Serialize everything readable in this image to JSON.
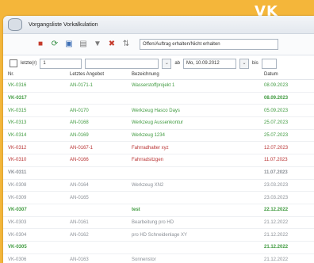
{
  "badge": "VK",
  "window": {
    "title": "Vorgangsliste Vorkalkulation"
  },
  "toolbar": {
    "filter_select": "Offen/Auftrag erhalten/Nicht erhalten"
  },
  "filterbar": {
    "checkbox_label": "letzte(r)",
    "count_value": "1",
    "unit_select": "",
    "ab_label": "ab",
    "date_value": "Mo, 10.09.2012",
    "bis_label": "bis"
  },
  "table": {
    "headers": [
      "Nr.",
      "Letztes Angebot",
      "Bezeichnung",
      "Datum"
    ],
    "rows": [
      {
        "nr": "VK-0316",
        "angebot": "AN-0171-1",
        "bez": "Wasserstoffprojekt 1",
        "datum": "08.09.2023",
        "style": "green"
      },
      {
        "nr": "VK-0317",
        "angebot": "",
        "bez": "",
        "datum": "08.09.2023",
        "style": "green-bold"
      },
      {
        "nr": "VK-0315",
        "angebot": "AN-0170",
        "bez": "Werkzeug Hasco Days",
        "datum": "05.09.2023",
        "style": "green"
      },
      {
        "nr": "VK-0313",
        "angebot": "AN-0168",
        "bez": "Werkzeug Aussenkontur",
        "datum": "25.07.2023",
        "style": "green"
      },
      {
        "nr": "VK-0314",
        "angebot": "AN-0169",
        "bez": "Werkzeug 1234",
        "datum": "25.07.2023",
        "style": "green"
      },
      {
        "nr": "VK-0312",
        "angebot": "AN-0167-1",
        "bez": "Fahrradhalter xyz",
        "datum": "12.07.2023",
        "style": "red"
      },
      {
        "nr": "VK-0310",
        "angebot": "AN-0166",
        "bez": "Fahrradsitzgen",
        "datum": "11.07.2023",
        "style": "red"
      },
      {
        "nr": "VK-0311",
        "angebot": "",
        "bez": "",
        "datum": "11.07.2023",
        "style": "gray-bold"
      },
      {
        "nr": "VK-0308",
        "angebot": "AN-0164",
        "bez": "Werkzeug XN2",
        "datum": "23.03.2023",
        "style": "gray"
      },
      {
        "nr": "VK-0309",
        "angebot": "AN-0165",
        "bez": "",
        "datum": "23.03.2023",
        "style": "gray"
      },
      {
        "nr": "VK-0307",
        "angebot": "",
        "bez": "test",
        "datum": "22.12.2022",
        "style": "green-bold"
      },
      {
        "nr": "VK-0303",
        "angebot": "AN-0161",
        "bez": "Bearbeitung pro HD",
        "datum": "21.12.2022",
        "style": "gray"
      },
      {
        "nr": "VK-0304",
        "angebot": "AN-0162",
        "bez": "pro HD Schneidenlage XY",
        "datum": "21.12.2022",
        "style": "gray"
      },
      {
        "nr": "VK-0305",
        "angebot": "",
        "bez": "",
        "datum": "21.12.2022",
        "style": "green-bold"
      },
      {
        "nr": "VK-0306",
        "angebot": "AN-0163",
        "bez": "Sonnenstor",
        "datum": "21.12.2022",
        "style": "gray"
      }
    ]
  },
  "colors": {
    "green": "#3f9a3f",
    "red": "#b83232",
    "gray": "#8a8f96",
    "banner": "#f4b63a"
  }
}
